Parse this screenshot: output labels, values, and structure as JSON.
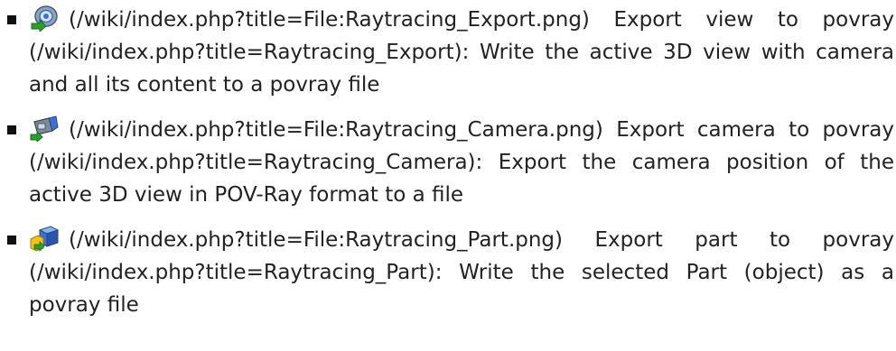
{
  "items": [
    {
      "icon": "raytracing-export-icon",
      "image_link": "(/wiki/index.php?title=File:Raytracing_Export.png)",
      "label": "Export view to povray",
      "page_link": "(/wiki/index.php?title=Raytracing_Export)",
      "description": ": Write the active 3D view with camera and all its content to a povray file"
    },
    {
      "icon": "raytracing-camera-icon",
      "image_link": "(/wiki/index.php?title=File:Raytracing_Camera.png)",
      "label": "Export camera to povray",
      "page_link": "(/wiki/index.php?title=Raytracing_Camera)",
      "description": ": Export the camera position of the active 3D view in POV-Ray format to a file"
    },
    {
      "icon": "raytracing-part-icon",
      "image_link": "(/wiki/index.php?title=File:Raytracing_Part.png)",
      "label": "Export part to povray",
      "page_link": "(/wiki/index.php?title=Raytracing_Part)",
      "description": ": Write the selected Part (object) as a povray file"
    }
  ],
  "colors": {
    "text": "#222222",
    "bullet": "#111111",
    "icon_green": "#2e9e2e",
    "icon_blue": "#3b6fd1",
    "icon_yellow": "#f2c21b"
  }
}
